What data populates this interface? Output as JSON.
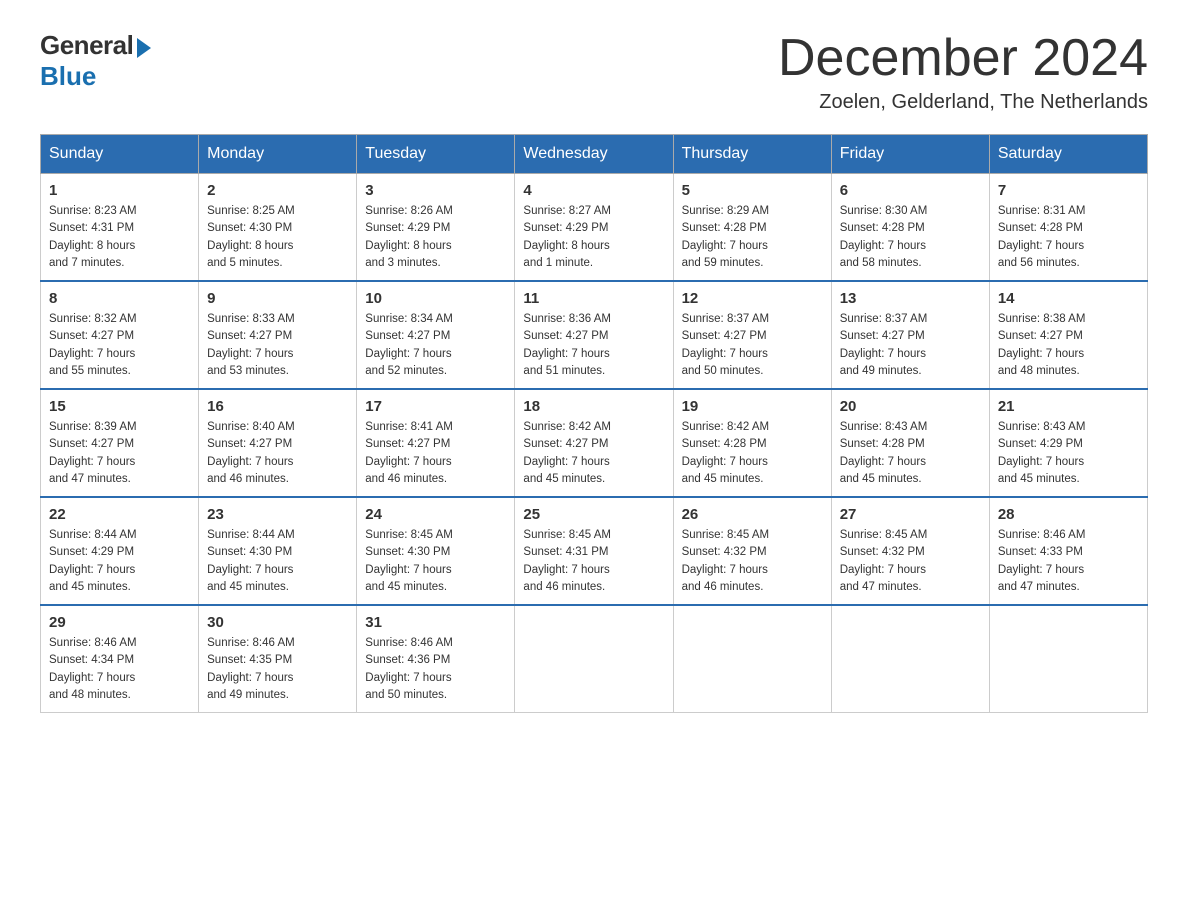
{
  "header": {
    "logo_general": "General",
    "logo_blue": "Blue",
    "month_title": "December 2024",
    "location": "Zoelen, Gelderland, The Netherlands"
  },
  "days_of_week": [
    "Sunday",
    "Monday",
    "Tuesday",
    "Wednesday",
    "Thursday",
    "Friday",
    "Saturday"
  ],
  "weeks": [
    [
      {
        "day": "1",
        "info": "Sunrise: 8:23 AM\nSunset: 4:31 PM\nDaylight: 8 hours\nand 7 minutes."
      },
      {
        "day": "2",
        "info": "Sunrise: 8:25 AM\nSunset: 4:30 PM\nDaylight: 8 hours\nand 5 minutes."
      },
      {
        "day": "3",
        "info": "Sunrise: 8:26 AM\nSunset: 4:29 PM\nDaylight: 8 hours\nand 3 minutes."
      },
      {
        "day": "4",
        "info": "Sunrise: 8:27 AM\nSunset: 4:29 PM\nDaylight: 8 hours\nand 1 minute."
      },
      {
        "day": "5",
        "info": "Sunrise: 8:29 AM\nSunset: 4:28 PM\nDaylight: 7 hours\nand 59 minutes."
      },
      {
        "day": "6",
        "info": "Sunrise: 8:30 AM\nSunset: 4:28 PM\nDaylight: 7 hours\nand 58 minutes."
      },
      {
        "day": "7",
        "info": "Sunrise: 8:31 AM\nSunset: 4:28 PM\nDaylight: 7 hours\nand 56 minutes."
      }
    ],
    [
      {
        "day": "8",
        "info": "Sunrise: 8:32 AM\nSunset: 4:27 PM\nDaylight: 7 hours\nand 55 minutes."
      },
      {
        "day": "9",
        "info": "Sunrise: 8:33 AM\nSunset: 4:27 PM\nDaylight: 7 hours\nand 53 minutes."
      },
      {
        "day": "10",
        "info": "Sunrise: 8:34 AM\nSunset: 4:27 PM\nDaylight: 7 hours\nand 52 minutes."
      },
      {
        "day": "11",
        "info": "Sunrise: 8:36 AM\nSunset: 4:27 PM\nDaylight: 7 hours\nand 51 minutes."
      },
      {
        "day": "12",
        "info": "Sunrise: 8:37 AM\nSunset: 4:27 PM\nDaylight: 7 hours\nand 50 minutes."
      },
      {
        "day": "13",
        "info": "Sunrise: 8:37 AM\nSunset: 4:27 PM\nDaylight: 7 hours\nand 49 minutes."
      },
      {
        "day": "14",
        "info": "Sunrise: 8:38 AM\nSunset: 4:27 PM\nDaylight: 7 hours\nand 48 minutes."
      }
    ],
    [
      {
        "day": "15",
        "info": "Sunrise: 8:39 AM\nSunset: 4:27 PM\nDaylight: 7 hours\nand 47 minutes."
      },
      {
        "day": "16",
        "info": "Sunrise: 8:40 AM\nSunset: 4:27 PM\nDaylight: 7 hours\nand 46 minutes."
      },
      {
        "day": "17",
        "info": "Sunrise: 8:41 AM\nSunset: 4:27 PM\nDaylight: 7 hours\nand 46 minutes."
      },
      {
        "day": "18",
        "info": "Sunrise: 8:42 AM\nSunset: 4:27 PM\nDaylight: 7 hours\nand 45 minutes."
      },
      {
        "day": "19",
        "info": "Sunrise: 8:42 AM\nSunset: 4:28 PM\nDaylight: 7 hours\nand 45 minutes."
      },
      {
        "day": "20",
        "info": "Sunrise: 8:43 AM\nSunset: 4:28 PM\nDaylight: 7 hours\nand 45 minutes."
      },
      {
        "day": "21",
        "info": "Sunrise: 8:43 AM\nSunset: 4:29 PM\nDaylight: 7 hours\nand 45 minutes."
      }
    ],
    [
      {
        "day": "22",
        "info": "Sunrise: 8:44 AM\nSunset: 4:29 PM\nDaylight: 7 hours\nand 45 minutes."
      },
      {
        "day": "23",
        "info": "Sunrise: 8:44 AM\nSunset: 4:30 PM\nDaylight: 7 hours\nand 45 minutes."
      },
      {
        "day": "24",
        "info": "Sunrise: 8:45 AM\nSunset: 4:30 PM\nDaylight: 7 hours\nand 45 minutes."
      },
      {
        "day": "25",
        "info": "Sunrise: 8:45 AM\nSunset: 4:31 PM\nDaylight: 7 hours\nand 46 minutes."
      },
      {
        "day": "26",
        "info": "Sunrise: 8:45 AM\nSunset: 4:32 PM\nDaylight: 7 hours\nand 46 minutes."
      },
      {
        "day": "27",
        "info": "Sunrise: 8:45 AM\nSunset: 4:32 PM\nDaylight: 7 hours\nand 47 minutes."
      },
      {
        "day": "28",
        "info": "Sunrise: 8:46 AM\nSunset: 4:33 PM\nDaylight: 7 hours\nand 47 minutes."
      }
    ],
    [
      {
        "day": "29",
        "info": "Sunrise: 8:46 AM\nSunset: 4:34 PM\nDaylight: 7 hours\nand 48 minutes."
      },
      {
        "day": "30",
        "info": "Sunrise: 8:46 AM\nSunset: 4:35 PM\nDaylight: 7 hours\nand 49 minutes."
      },
      {
        "day": "31",
        "info": "Sunrise: 8:46 AM\nSunset: 4:36 PM\nDaylight: 7 hours\nand 50 minutes."
      },
      {
        "day": "",
        "info": ""
      },
      {
        "day": "",
        "info": ""
      },
      {
        "day": "",
        "info": ""
      },
      {
        "day": "",
        "info": ""
      }
    ]
  ]
}
